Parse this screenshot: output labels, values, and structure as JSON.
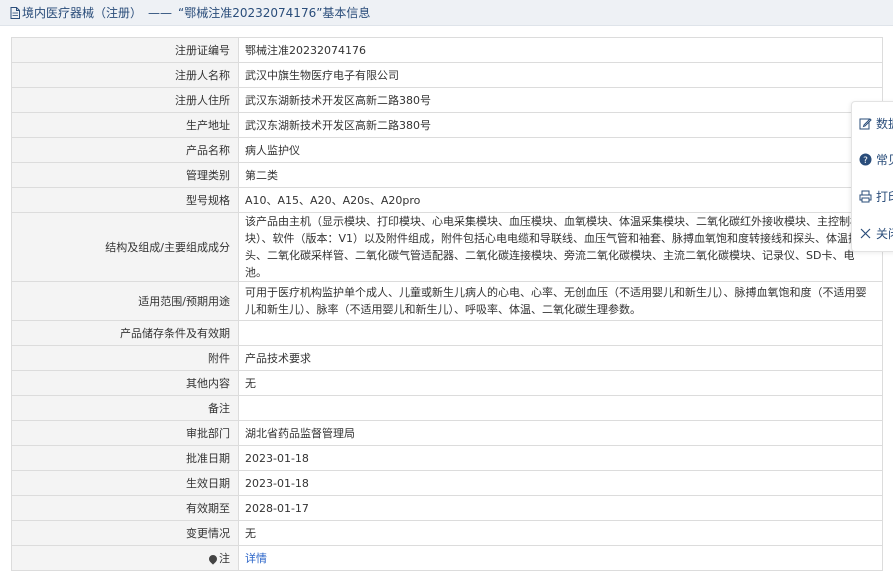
{
  "header": {
    "category": "境内医疗器械（注册）",
    "separator": "——",
    "title": "“鄂械注准20232074176”基本信息"
  },
  "rows": [
    {
      "label": "注册证编号",
      "value": "鄂械注准20232074176"
    },
    {
      "label": "注册人名称",
      "value": "武汉中旗生物医疗电子有限公司"
    },
    {
      "label": "注册人住所",
      "value": "武汉东湖新技术开发区高新二路380号"
    },
    {
      "label": "生产地址",
      "value": "武汉东湖新技术开发区高新二路380号"
    },
    {
      "label": "产品名称",
      "value": "病人监护仪"
    },
    {
      "label": "管理类别",
      "value": "第二类"
    },
    {
      "label": "型号规格",
      "value": "A10、A15、A20、A20s、A20pro"
    },
    {
      "label": "结构及组成/主要组成成分",
      "value": "该产品由主机（显示模块、打印模块、心电采集模块、血压模块、血氧模块、体温采集模块、二氧化碳红外接收模块、主控制模块）、软件（版本：V1）以及附件组成，附件包括心电电缆和导联线、血压气管和袖套、脉搏血氧饱和度转接线和探头、体温探头、二氧化碳采样管、二氧化碳气管适配器、二氧化碳连接模块、旁流二氧化碳模块、主流二氧化碳模块、记录仪、SD卡、电池。"
    },
    {
      "label": "适用范围/预期用途",
      "value": "可用于医疗机构监护单个成人、儿童或新生儿病人的心电、心率、无创血压（不适用婴儿和新生儿）、脉搏血氧饱和度（不适用婴儿和新生儿）、脉率（不适用婴儿和新生儿）、呼吸率、体温、二氧化碳生理参数。"
    },
    {
      "label": "产品储存条件及有效期",
      "value": ""
    },
    {
      "label": "附件",
      "value": "产品技术要求"
    },
    {
      "label": "其他内容",
      "value": "无"
    },
    {
      "label": "备注",
      "value": ""
    },
    {
      "label": "审批部门",
      "value": "湖北省药品监督管理局"
    },
    {
      "label": "批准日期",
      "value": "2023-01-18"
    },
    {
      "label": "生效日期",
      "value": "2023-01-18"
    },
    {
      "label": "有效期至",
      "value": "2028-01-17"
    },
    {
      "label": "变更情况",
      "value": "无"
    }
  ],
  "note_row": {
    "label": "注",
    "link": "详情"
  },
  "float_panel": [
    {
      "label": "数据",
      "icon": "edit-icon"
    },
    {
      "label": "常见",
      "icon": "question-icon"
    },
    {
      "label": "打印",
      "icon": "print-icon"
    },
    {
      "label": "关闭",
      "icon": "close-icon"
    }
  ]
}
